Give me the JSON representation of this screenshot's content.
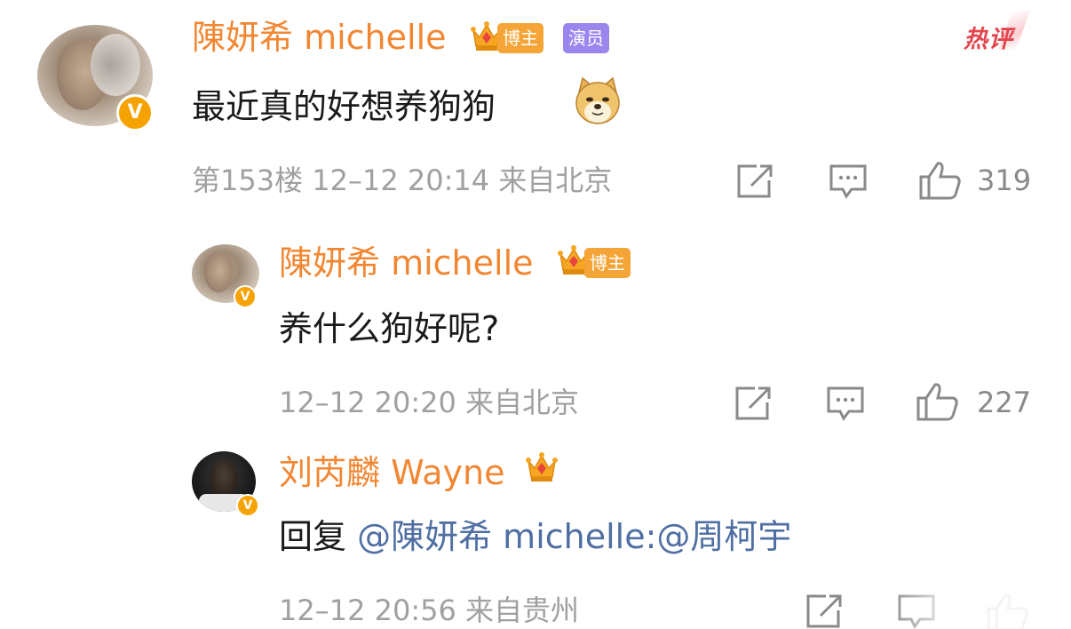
{
  "hot_label": "热评",
  "comments": [
    {
      "username": "陳妍希 michelle",
      "tags": [
        "博主",
        "演员"
      ],
      "text": "最近真的好想养狗狗",
      "meta": "第153楼 12–12 20:14 来自北京",
      "likes": "319",
      "verified_badge": "V"
    },
    {
      "username": "陳妍希 michelle",
      "tags": [
        "博主"
      ],
      "text": "养什么狗好呢?",
      "meta": "12–12 20:20 来自北京",
      "likes": "227",
      "verified_badge": "V"
    },
    {
      "username": "刘芮麟 Wayne",
      "tags": [],
      "text_prefix": "回复 ",
      "text_mention": "@陳妍希 michelle:@周柯宇",
      "meta": "12–12 20:56 来自贵州",
      "verified_badge": "V"
    }
  ],
  "colors": {
    "username": "#f28733",
    "mention": "#4f6fa3",
    "blogger_tag": "#f5a538",
    "actor_tag": "#9b86ee",
    "hot_label": "#e3454d",
    "verified_badge": "#f6a200"
  },
  "icons": [
    "crown-icon",
    "share-icon",
    "comment-icon",
    "like-icon",
    "dog-emoji"
  ]
}
